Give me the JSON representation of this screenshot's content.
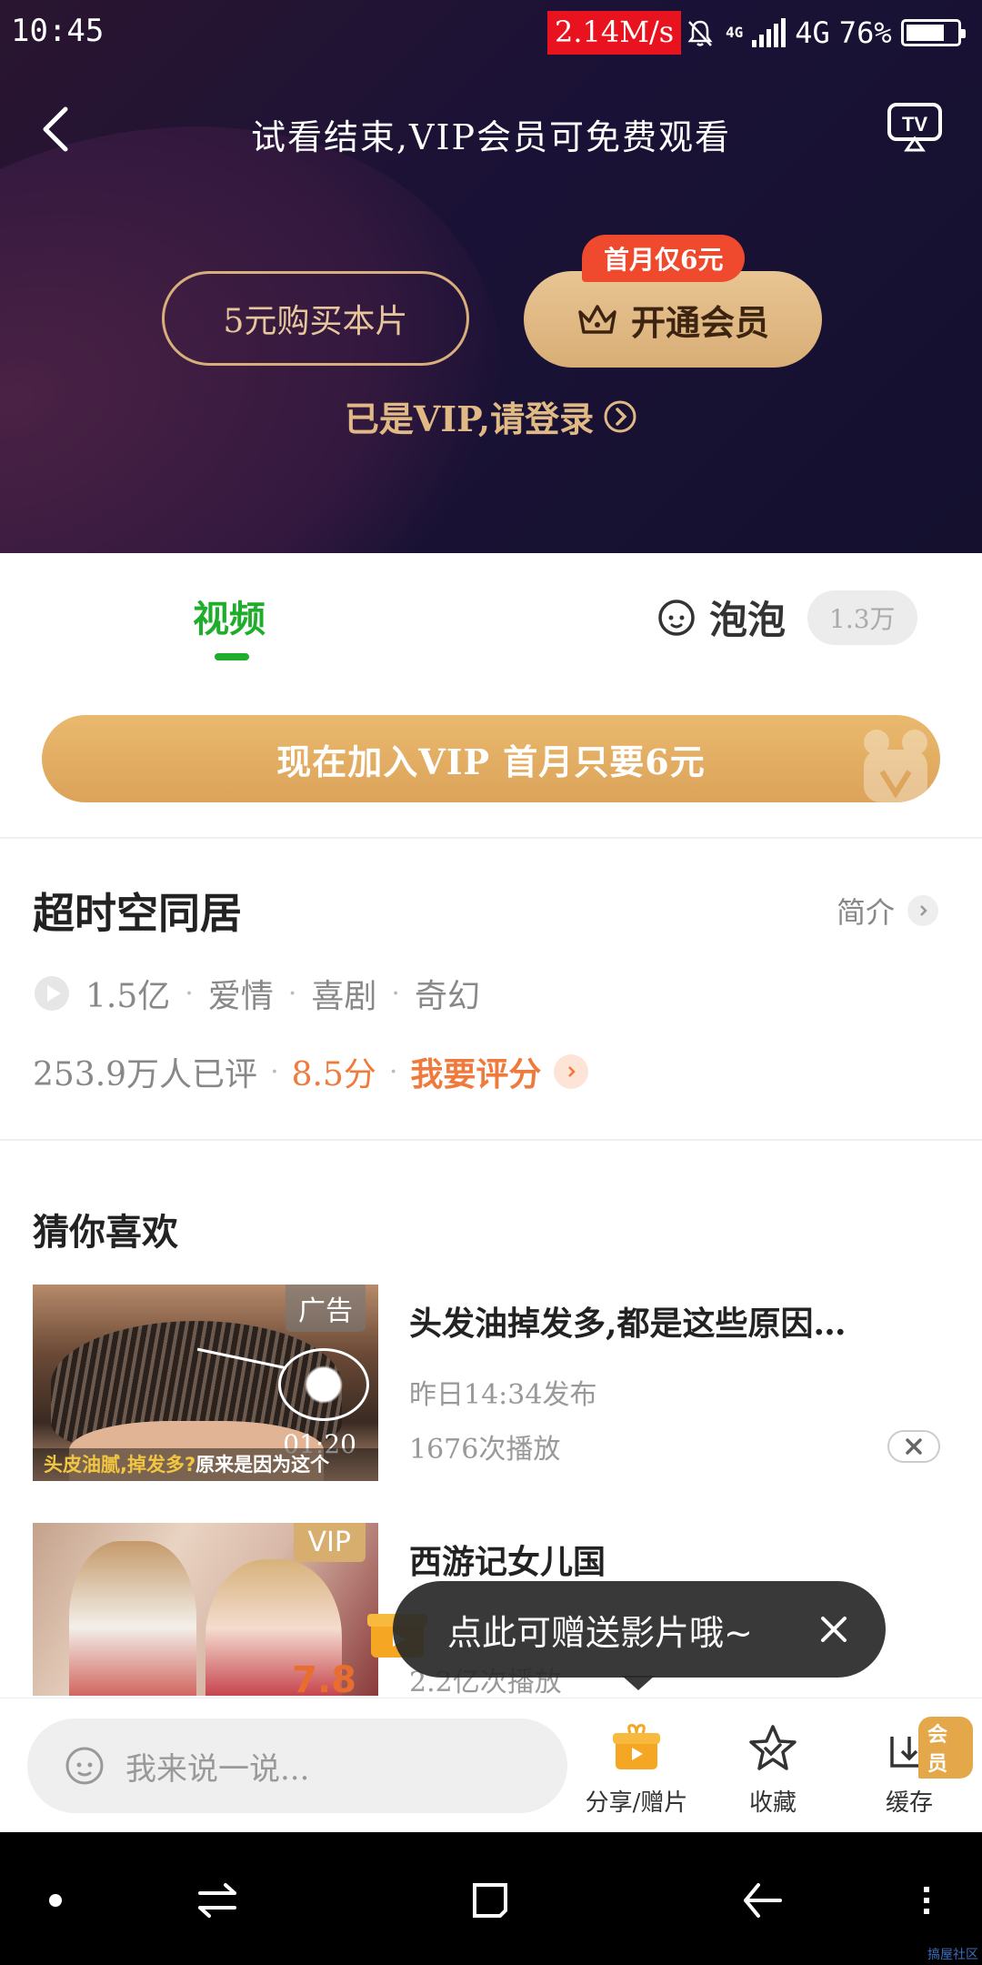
{
  "status_bar": {
    "time": "10:45",
    "net_speed": "2.14M/s",
    "network_small": "4G",
    "network": "4G",
    "battery": "76%"
  },
  "player": {
    "message": "试看结束,VIP会员可免费观看",
    "buy_button": "5元购买本片",
    "vip_button": "开通会员",
    "vip_badge": "首月仅6元",
    "login_link": "已是VIP,请登录"
  },
  "tabs": {
    "video": "视频",
    "bubble": "泡泡",
    "bubble_count": "1.3万"
  },
  "vip_banner": "现在加入VIP  首月只要6元",
  "show": {
    "title": "超时空同居",
    "intro": "简介",
    "plays": "1.5亿",
    "genres": [
      "爱情",
      "喜剧",
      "奇幻"
    ],
    "rating_count": "253.9万人已评",
    "score": "8.5分",
    "rate_link": "我要评分"
  },
  "recommend": {
    "title": "猜你喜欢",
    "items": [
      {
        "title": "头发油掉发多,都是这些原因…",
        "line1": "昨日14:34发布",
        "line2": "1676次播放",
        "tag": "广告",
        "duration": "01:20",
        "caption_highlight": "头皮油腻,掉发多?",
        "caption_rest": "原来是因为这个"
      },
      {
        "title": "西游记女儿国",
        "line2": "2.2亿次播放",
        "tag": "VIP",
        "score": "7.8"
      }
    ]
  },
  "tooltip": "点此可赠送影片哦~",
  "action_bar": {
    "comment_placeholder": "我来说一说...",
    "share": "分享/赠片",
    "favorite": "收藏",
    "cache": "缓存",
    "member_badge": "会员"
  },
  "watermark": "搞屋社区",
  "colors": {
    "accent_green": "#1fae2b",
    "vip_gold": "#d9ae76",
    "score_orange": "#f07a3c",
    "badge_red": "#ef4a2d"
  },
  "icons": [
    "back-icon",
    "tv-cast-icon",
    "crown-icon",
    "chevron-right-icon",
    "bubble-face-icon",
    "play-icon",
    "close-icon",
    "gift-icon",
    "star-icon",
    "download-icon",
    "smile-icon"
  ]
}
